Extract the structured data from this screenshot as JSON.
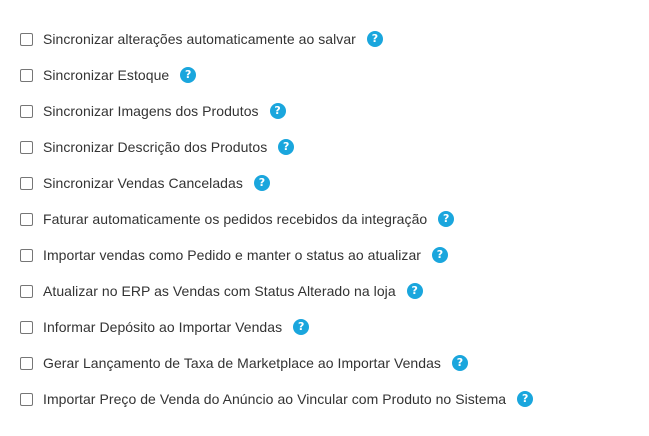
{
  "colors": {
    "help_icon": "#1aa6dd",
    "label_text": "#333333",
    "checkbox_border": "#767676"
  },
  "help_glyph": "?",
  "options": [
    {
      "label": "Sincronizar alterações automaticamente ao salvar",
      "checked": false
    },
    {
      "label": "Sincronizar Estoque",
      "checked": false
    },
    {
      "label": "Sincronizar Imagens dos Produtos",
      "checked": false
    },
    {
      "label": "Sincronizar Descrição dos Produtos",
      "checked": false
    },
    {
      "label": "Sincronizar Vendas Canceladas",
      "checked": false
    },
    {
      "label": "Faturar automaticamente os pedidos recebidos da integração",
      "checked": false
    },
    {
      "label": "Importar vendas como Pedido e manter o status ao atualizar",
      "checked": false
    },
    {
      "label": "Atualizar no ERP as Vendas com Status Alterado na loja",
      "checked": false
    },
    {
      "label": "Informar Depósito ao Importar Vendas",
      "checked": false
    },
    {
      "label": "Gerar Lançamento de Taxa de Marketplace ao Importar Vendas",
      "checked": false
    },
    {
      "label": "Importar Preço de Venda do Anúncio ao Vincular com Produto no Sistema",
      "checked": false
    }
  ]
}
